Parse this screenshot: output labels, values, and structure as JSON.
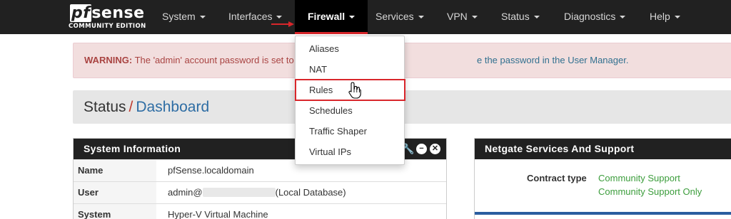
{
  "brand": {
    "name_pf": "pf",
    "name_rest": "sense",
    "edition": "COMMUNITY EDITION"
  },
  "nav": {
    "items": [
      "System",
      "Interfaces",
      "Firewall",
      "Services",
      "VPN",
      "Status",
      "Diagnostics",
      "Help"
    ],
    "active": "Firewall"
  },
  "alert": {
    "strong": "WARNING:",
    "text": "The 'admin' account password is set to",
    "link_text": "e the password in the User Manager."
  },
  "breadcrumb": {
    "parent": "Status",
    "separator": "/",
    "current": "Dashboard"
  },
  "system_info": {
    "title": "System Information",
    "rows": [
      {
        "label": "Name",
        "value": "pfSense.localdomain"
      },
      {
        "label": "User",
        "value_prefix": "admin@",
        "value_suffix": "(Local Database)"
      },
      {
        "label": "System",
        "value": "Hyper-V Virtual Machine"
      }
    ]
  },
  "netgate": {
    "title": "Netgate Services And Support",
    "contract_label": "Contract type",
    "contract_lines": [
      "Community Support",
      "Community Support Only"
    ]
  },
  "firewall_menu": {
    "items": [
      "Aliases",
      "NAT",
      "Rules",
      "Schedules",
      "Traffic Shaper",
      "Virtual IPs"
    ],
    "highlighted": "Rules"
  },
  "colors": {
    "navbar": "#212121",
    "accent_red": "#d9262b",
    "link_blue": "#2e6da4",
    "support_green": "#3c9d3c"
  }
}
